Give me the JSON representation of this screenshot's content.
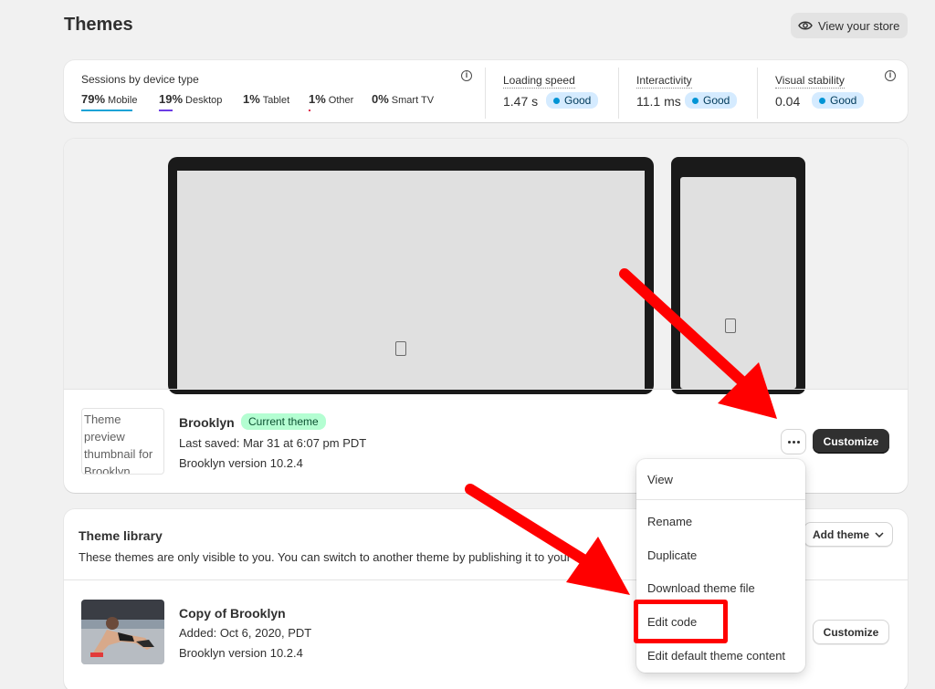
{
  "header": {
    "title": "Themes",
    "view_store": "View your store"
  },
  "metrics": {
    "sessions_title": "Sessions by device type",
    "devices": [
      {
        "pct": "79%",
        "name": "Mobile",
        "color": "#1ba3d6"
      },
      {
        "pct": "19%",
        "name": "Desktop",
        "color": "#6b3ce4"
      },
      {
        "pct": "1%",
        "name": "Tablet",
        "color": "#e0a000"
      },
      {
        "pct": "1%",
        "name": "Other",
        "color": "#e0204a"
      },
      {
        "pct": "0%",
        "name": "Smart TV",
        "color": "#cccccc"
      }
    ],
    "loading_speed": {
      "label": "Loading speed",
      "value": "1.47 s",
      "badge": "Good"
    },
    "interactivity": {
      "label": "Interactivity",
      "value": "11.1 ms",
      "badge": "Good"
    },
    "visual_stability": {
      "label": "Visual stability",
      "value": "0.04",
      "badge": "Good"
    }
  },
  "current_theme": {
    "thumb_alt": "Theme preview thumbnail for Brooklyn",
    "name": "Brooklyn",
    "badge": "Current theme",
    "last_saved": "Last saved: Mar 31 at 6:07 pm PDT",
    "version": "Brooklyn version 10.2.4",
    "customize": "Customize"
  },
  "library": {
    "title": "Theme library",
    "description": "These themes are only visible to you. You can switch to another theme by publishing it to your store.",
    "add_theme": "Add theme",
    "items": [
      {
        "name": "Copy of Brooklyn",
        "added": "Added: Oct 6, 2020, PDT",
        "version": "Brooklyn version 10.2.4",
        "customize": "Customize"
      }
    ]
  },
  "menu": {
    "items": [
      "View",
      "Rename",
      "Duplicate",
      "Download theme file",
      "Edit code",
      "Edit default theme content"
    ]
  },
  "colors": {
    "arrow": "#ff0000",
    "primary_button": "#303030",
    "good_badge": "#d5ebff",
    "current_badge": "#b4fed2"
  }
}
